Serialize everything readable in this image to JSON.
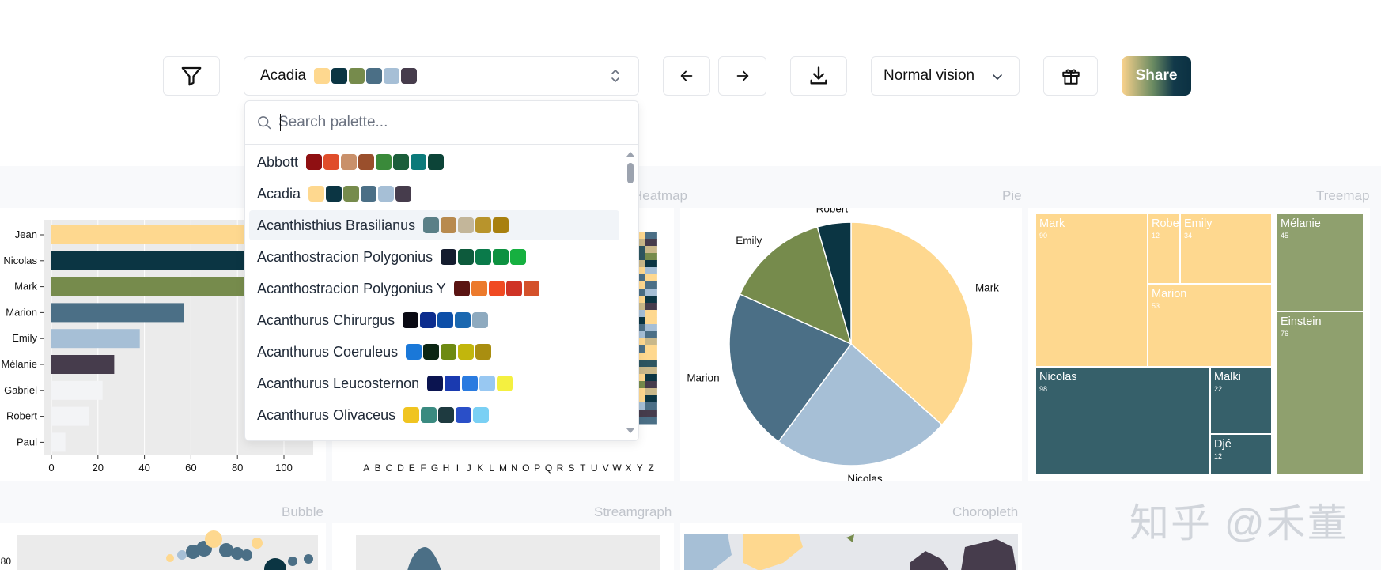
{
  "toolbar": {
    "palette_name": "Acadia",
    "palette_colors": [
      "#fed88f",
      "#0b3543",
      "#768b4c",
      "#4b6f86",
      "#a6bfd6",
      "#463c4c"
    ],
    "vision_label": "Normal vision",
    "share_label": "Share"
  },
  "search": {
    "placeholder": "Search palette..."
  },
  "palettes": [
    {
      "name": "Abbott",
      "colors": [
        "#8f1012",
        "#e04d2b",
        "#c9906a",
        "#9a4f2c",
        "#3a8a3a",
        "#1b5e3a",
        "#0b7a7a",
        "#0c4438"
      ]
    },
    {
      "name": "Acadia",
      "colors": [
        "#fed88f",
        "#0b3543",
        "#768b4c",
        "#4b6f86",
        "#a6bfd6",
        "#463c4c"
      ]
    },
    {
      "name": "Acanthisthius Brasilianus",
      "colors": [
        "#5a7f87",
        "#b88a4f",
        "#c3b69a",
        "#b8942c",
        "#a8800f"
      ]
    },
    {
      "name": "Acanthostracion Polygonius",
      "colors": [
        "#141c2e",
        "#0d5a3c",
        "#0a7a4a",
        "#0d9140",
        "#16b040"
      ]
    },
    {
      "name": "Acanthostracion Polygonius Y",
      "colors": [
        "#5a1412",
        "#ec7a2c",
        "#f04a22",
        "#cf3326",
        "#d4512b"
      ]
    },
    {
      "name": "Acanthurus Chirurgus",
      "colors": [
        "#0a0a14",
        "#0c2d8e",
        "#0d4fa8",
        "#1b68b0",
        "#8eaabf"
      ]
    },
    {
      "name": "Acanthurus Coeruleus",
      "colors": [
        "#1a78d8",
        "#0c2614",
        "#6e8a12",
        "#c2b60c",
        "#a98e10"
      ]
    },
    {
      "name": "Acanthurus Leucosternon",
      "colors": [
        "#0b1450",
        "#1a3ab0",
        "#2a7be0",
        "#98c8f2",
        "#f4f040"
      ]
    },
    {
      "name": "Acanthurus Olivaceus",
      "colors": [
        "#f0c420",
        "#3a8a80",
        "#1e3a40",
        "#2a4fc8",
        "#7ad0f4"
      ]
    }
  ],
  "panels": {
    "heatmap": "Heatmap",
    "pie": "Pie",
    "treemap": "Treemap",
    "bubble": "Bubble",
    "streamgraph": "Streamgraph",
    "choropleth": "Choropleth"
  },
  "chart_data": [
    {
      "type": "bar",
      "orientation": "horizontal",
      "categories": [
        "Jean",
        "Nicolas",
        "Mark",
        "Marion",
        "Emily",
        "Mélanie",
        "Gabriel",
        "Robert",
        "Paul"
      ],
      "values": [
        93,
        98,
        90,
        57,
        38,
        27,
        22,
        16,
        6
      ],
      "xticks": [
        0,
        20,
        40,
        60,
        80,
        100
      ],
      "xlim": [
        0,
        112
      ],
      "colors": [
        "#fed88f",
        "#0b3543",
        "#768b4c",
        "#4b6f86",
        "#a6bfd6",
        "#463c4c",
        "#f3f4f6",
        "#f3f4f6",
        "#f3f4f6"
      ]
    },
    {
      "type": "heatmap",
      "title": "Heatmap",
      "xticks": [
        "A",
        "B",
        "C",
        "D",
        "E",
        "F",
        "G",
        "H",
        "I",
        "J",
        "K",
        "L",
        "M",
        "N",
        "O",
        "P",
        "Q",
        "R",
        "S",
        "T",
        "U",
        "V",
        "W",
        "X",
        "Y",
        "Z"
      ]
    },
    {
      "type": "pie",
      "title": "Pie",
      "slices": [
        {
          "label": "Mark",
          "value": 90,
          "color": "#fed88f"
        },
        {
          "label": "Nicolas",
          "value": 58,
          "color": "#a6bfd6"
        },
        {
          "label": "Marion",
          "value": 53,
          "color": "#4b6f86"
        },
        {
          "label": "Emily",
          "value": 34,
          "color": "#768b4c"
        },
        {
          "label": "Robert",
          "value": 11,
          "color": "#0b3543"
        }
      ]
    },
    {
      "type": "treemap",
      "title": "Treemap",
      "items": [
        {
          "label": "Mark",
          "value": "90",
          "color": "#fed88f"
        },
        {
          "label": "Robe",
          "value": "12",
          "color": "#fed88f"
        },
        {
          "label": "Emily",
          "value": "34",
          "color": "#fed88f"
        },
        {
          "label": "Marion",
          "value": "53",
          "color": "#fed88f"
        },
        {
          "label": "Nicolas",
          "value": "98",
          "color": "#36606a"
        },
        {
          "label": "Malki",
          "value": "22",
          "color": "#36606a"
        },
        {
          "label": "Djé",
          "value": "12",
          "color": "#36606a"
        },
        {
          "label": "Mélanie",
          "value": "45",
          "color": "#8fa06e"
        },
        {
          "label": "Einstein",
          "value": "76",
          "color": "#8fa06e"
        }
      ]
    },
    {
      "type": "scatter",
      "title": "Bubble",
      "yticks": [
        80
      ]
    }
  ],
  "watermark": "知乎 @禾董"
}
